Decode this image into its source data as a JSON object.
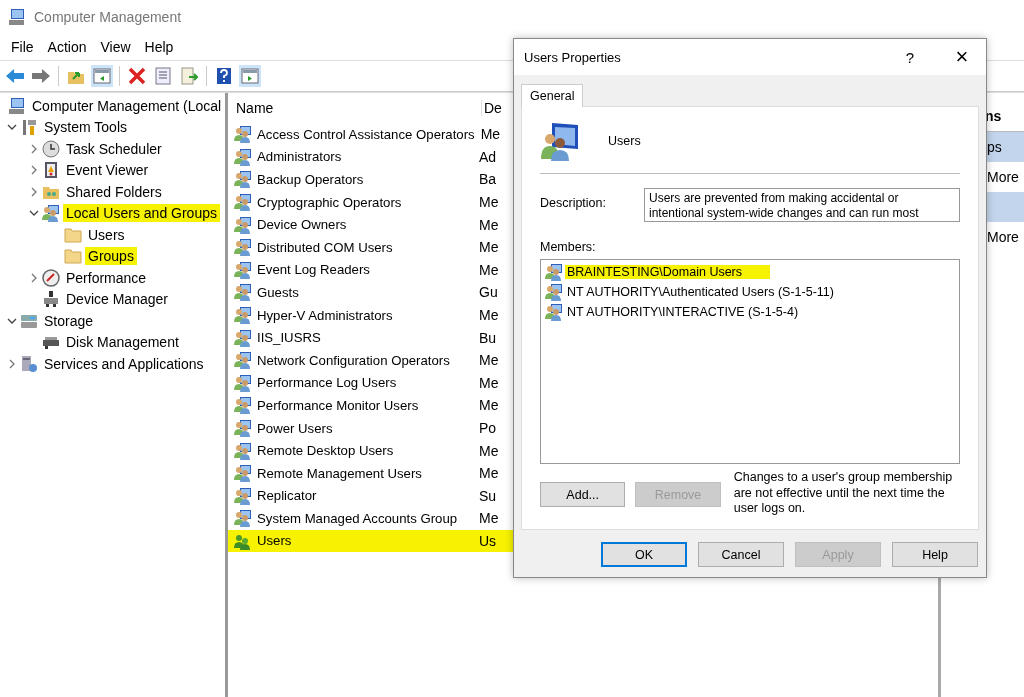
{
  "window": {
    "title": "Computer Management"
  },
  "menu": [
    "File",
    "Action",
    "View",
    "Help"
  ],
  "tree": [
    {
      "label": "Computer Management (Local",
      "kind": "computer",
      "highlighted": false,
      "children": [
        {
          "label": "System Tools",
          "kind": "tools",
          "expanded": true,
          "highlighted": false,
          "children": [
            {
              "label": "Task Scheduler",
              "kind": "clock",
              "expanded": false,
              "highlighted": false
            },
            {
              "label": "Event Viewer",
              "kind": "log",
              "expanded": false,
              "highlighted": false
            },
            {
              "label": "Shared Folders",
              "kind": "share",
              "expanded": false,
              "highlighted": false
            },
            {
              "label": "Local Users and Groups",
              "kind": "users",
              "expanded": true,
              "highlighted": true,
              "children": [
                {
                  "label": "Users",
                  "kind": "folder",
                  "highlighted": false
                },
                {
                  "label": "Groups",
                  "kind": "folder",
                  "highlighted": true
                }
              ]
            },
            {
              "label": "Performance",
              "kind": "gauge",
              "expanded": false,
              "highlighted": false
            },
            {
              "label": "Device Manager",
              "kind": "device",
              "highlighted": false
            }
          ]
        },
        {
          "label": "Storage",
          "kind": "storage",
          "expanded": true,
          "highlighted": false,
          "children": [
            {
              "label": "Disk Management",
              "kind": "disk",
              "highlighted": false
            }
          ]
        },
        {
          "label": "Services and Applications",
          "kind": "services",
          "expanded": false,
          "highlighted": false
        }
      ]
    }
  ],
  "table": {
    "columns": [
      "Name",
      "De"
    ],
    "rows": [
      {
        "name": "Access Control Assistance Operators",
        "column_2": "Me",
        "highlighted": false
      },
      {
        "name": "Administrators",
        "column_2": "Ad",
        "highlighted": false
      },
      {
        "name": "Backup Operators",
        "column_2": "Ba",
        "highlighted": false
      },
      {
        "name": "Cryptographic Operators",
        "column_2": "Me",
        "highlighted": false
      },
      {
        "name": "Device Owners",
        "column_2": "Me",
        "highlighted": false
      },
      {
        "name": "Distributed COM Users",
        "column_2": "Me",
        "highlighted": false
      },
      {
        "name": "Event Log Readers",
        "column_2": "Me",
        "highlighted": false
      },
      {
        "name": "Guests",
        "column_2": "Gu",
        "highlighted": false
      },
      {
        "name": "Hyper-V Administrators",
        "column_2": "Me",
        "highlighted": false
      },
      {
        "name": "IIS_IUSRS",
        "column_2": "Bu",
        "highlighted": false
      },
      {
        "name": "Network Configuration Operators",
        "column_2": "Me",
        "highlighted": false
      },
      {
        "name": "Performance Log Users",
        "column_2": "Me",
        "highlighted": false
      },
      {
        "name": "Performance Monitor Users",
        "column_2": "Me",
        "highlighted": false
      },
      {
        "name": "Power Users",
        "column_2": "Po",
        "highlighted": false
      },
      {
        "name": "Remote Desktop Users",
        "column_2": "Me",
        "highlighted": false
      },
      {
        "name": "Remote Management Users",
        "column_2": "Me",
        "highlighted": false
      },
      {
        "name": "Replicator",
        "column_2": "Su",
        "highlighted": false
      },
      {
        "name": "System Managed Accounts Group",
        "column_2": "Me",
        "highlighted": false
      },
      {
        "name": "Users",
        "column_2": "Us",
        "highlighted": true
      }
    ]
  },
  "actions": {
    "title": "ns",
    "items": [
      {
        "label": "ps",
        "kind": "header"
      },
      {
        "label": "More",
        "kind": "action"
      },
      {
        "kind": "header"
      },
      {
        "label": "More",
        "kind": "action"
      }
    ]
  },
  "dialog": {
    "title": "Users Properties",
    "help": "?",
    "close": "×",
    "tabs": [
      {
        "label": "General",
        "selected": true
      }
    ],
    "group_name": "Users",
    "description_label": "Description:",
    "description": "Users are prevented from making accidental or intentional system-wide changes and can run most",
    "members_label": "Members:",
    "members": [
      {
        "name": "BRAINTESTING\\Domain Users",
        "highlighted": true
      },
      {
        "name": "NT AUTHORITY\\Authenticated Users (S-1-5-11)",
        "highlighted": false
      },
      {
        "name": "NT AUTHORITY\\INTERACTIVE (S-1-5-4)",
        "highlighted": false
      }
    ],
    "member_buttons": [
      {
        "label": "Add...",
        "disabled": false
      },
      {
        "label": "Remove",
        "disabled": true
      }
    ],
    "note": "Changes to a user's group membership are not effective until the next time the user logs on.",
    "buttons": [
      {
        "label": "OK",
        "disabled": false,
        "default": true
      },
      {
        "label": "Cancel",
        "disabled": false,
        "default": false
      },
      {
        "label": "Apply",
        "disabled": true,
        "default": false
      },
      {
        "label": "Help",
        "disabled": false,
        "default": false
      }
    ]
  }
}
